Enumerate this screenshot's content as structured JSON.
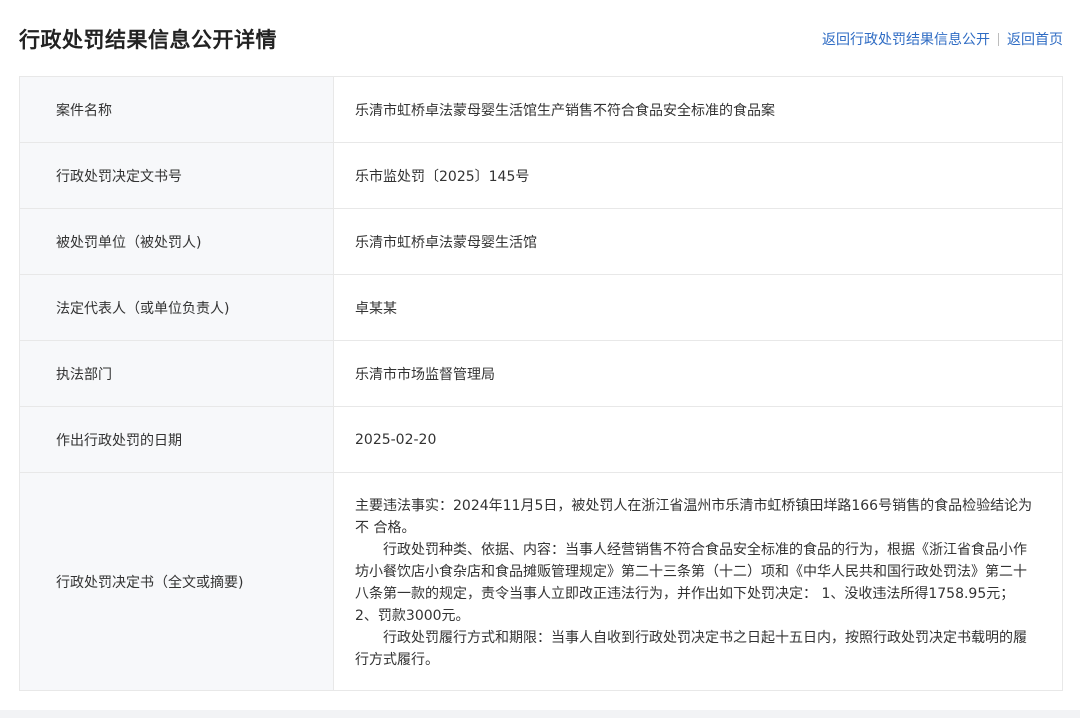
{
  "header": {
    "title": "行政处罚结果信息公开详情",
    "links": [
      {
        "label": "返回行政处罚结果信息公开"
      },
      {
        "label": "返回首页"
      }
    ]
  },
  "rows": [
    {
      "label": "案件名称",
      "value": "乐清市虹桥卓法蒙母婴生活馆生产销售不符合食品安全标准的食品案"
    },
    {
      "label": "行政处罚决定文书号",
      "value": "乐市监处罚〔2025〕145号"
    },
    {
      "label": "被处罚单位（被处罚人)",
      "value": "乐清市虹桥卓法蒙母婴生活馆"
    },
    {
      "label": "法定代表人（或单位负责人)",
      "value": "卓某某"
    },
    {
      "label": "执法部门",
      "value": "乐清市市场监督管理局"
    },
    {
      "label": "作出行政处罚的日期",
      "value": "2025-02-20"
    }
  ],
  "decision": {
    "label": "行政处罚决定书（全文或摘要)",
    "paragraphs": [
      "主要违法事实：2024年11月5日，被处罚人在浙江省温州市乐清市虹桥镇田垟路166号销售的食品检验结论为不 合格。",
      "行政处罚种类、依据、内容：当事人经营销售不符合食品安全标准的食品的行为，根据《浙江省食品小作坊小餐饮店小食杂店和食品摊贩管理规定》第二十三条第（十二）项和《中华人民共和国行政处罚法》第二十八条第一款的规定，责令当事人立即改正违法行为，并作出如下处罚决定： 1、没收违法所得1758.95元； 2、罚款3000元。",
      "行政处罚履行方式和期限：当事人自收到行政处罚决定书之日起十五日内，按照行政处罚决定书载明的履行方式履行。"
    ]
  },
  "colors": {
    "link": "#2f6cc4",
    "label_bg": "#f7f8fa",
    "border": "#e8e8e8"
  }
}
